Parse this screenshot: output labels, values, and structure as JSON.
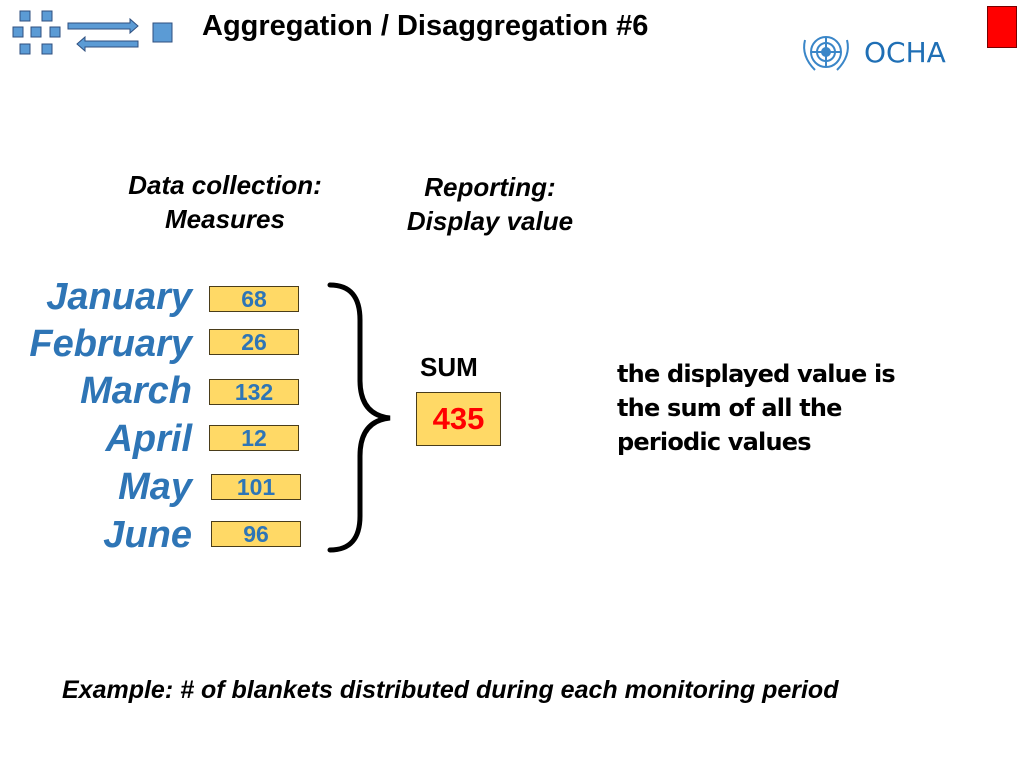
{
  "header": {
    "title": "Aggregation / Disaggregation #6",
    "logo_text": "OCHA",
    "icons": [
      "aggregation-icon",
      "un-emblem-icon",
      "red-square-marker"
    ]
  },
  "columns": {
    "left_heading_line1": "Data collection:",
    "left_heading_line2": "Measures",
    "right_heading_line1": "Reporting:",
    "right_heading_line2": "Display value"
  },
  "measures": [
    {
      "month": "January",
      "value": "68"
    },
    {
      "month": "February",
      "value": "26"
    },
    {
      "month": "March",
      "value": "132"
    },
    {
      "month": "April",
      "value": "12"
    },
    {
      "month": "May",
      "value": "101"
    },
    {
      "month": "June",
      "value": "96"
    }
  ],
  "result": {
    "label": "SUM",
    "value": "435"
  },
  "note": {
    "line1": "the displayed value is",
    "line2": "the sum of all the",
    "line3": "periodic values"
  },
  "example": "Example: # of blankets distributed during each monitoring period",
  "colors": {
    "month_text": "#2e75b6",
    "value_box": "#ffd966",
    "sum_value": "#ff0000",
    "accent_square": "#ff0000",
    "icon_blue": "#5b9bd5"
  }
}
